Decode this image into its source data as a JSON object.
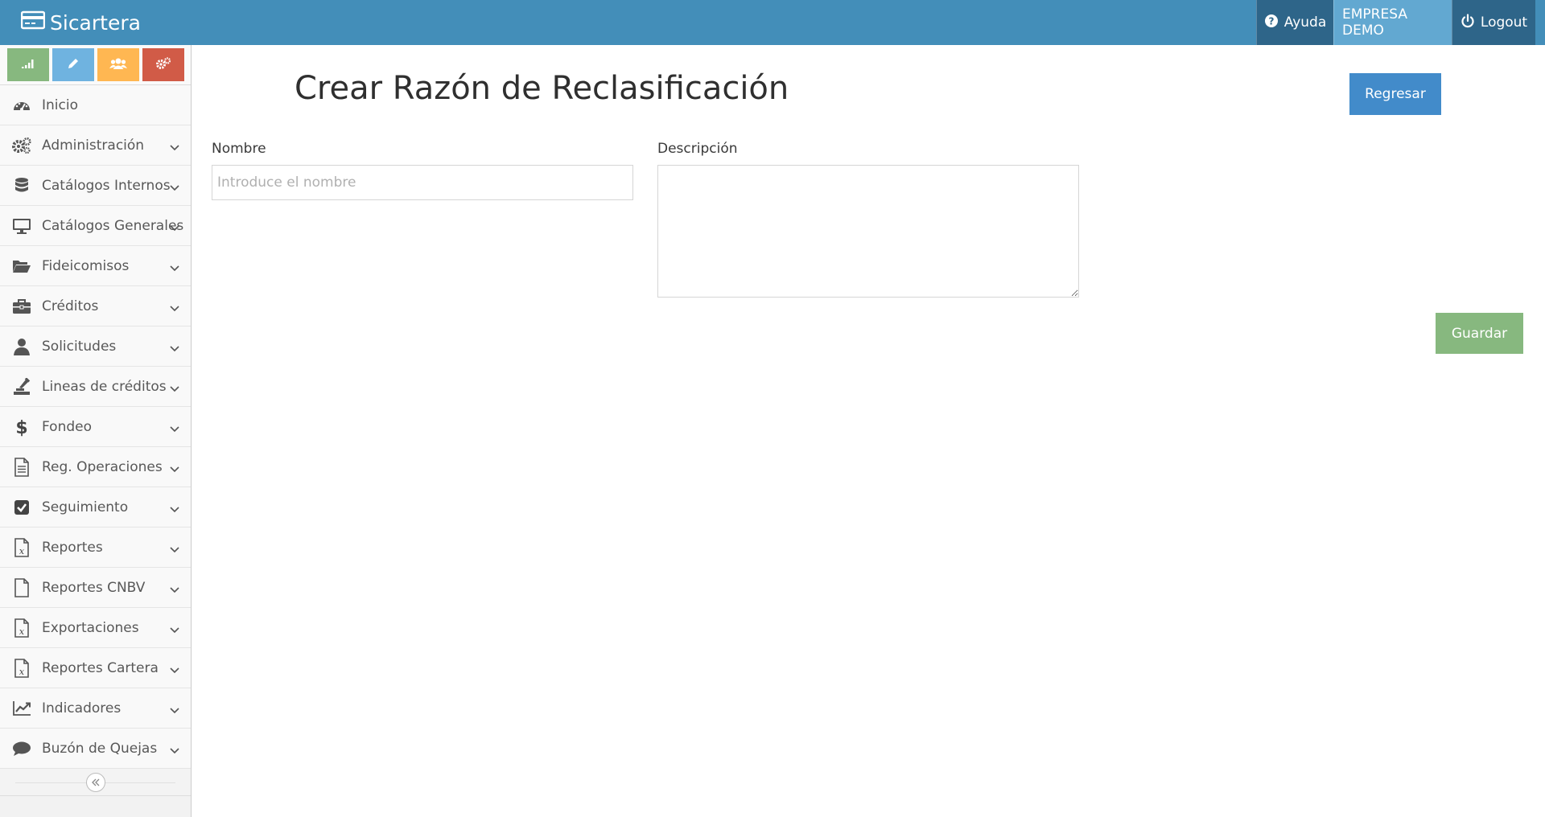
{
  "app": {
    "brand": "Sicartera",
    "brand_icon": "credit-card-icon"
  },
  "navbar": {
    "help_label": "Ayuda",
    "company_label": "EMPRESA DEMO",
    "logout_label": "Logout",
    "colors": {
      "bar": "#438eb9",
      "dark": "#2e6589",
      "company": "#62a8d1"
    }
  },
  "shortcuts": [
    {
      "icon": "signal-icon",
      "color": "#87b87f"
    },
    {
      "icon": "pencil-icon",
      "color": "#6fb3e0"
    },
    {
      "icon": "users-icon",
      "color": "#ffb752"
    },
    {
      "icon": "cogs-icon",
      "color": "#d15b47"
    }
  ],
  "sidebar": {
    "items": [
      {
        "label": "Inicio",
        "icon": "dashboard-icon",
        "has_submenu": false
      },
      {
        "label": "Administración",
        "icon": "cogs-icon",
        "has_submenu": true
      },
      {
        "label": "Catálogos Internos",
        "icon": "database-icon",
        "has_submenu": true
      },
      {
        "label": "Catálogos Generales",
        "icon": "desktop-icon",
        "has_submenu": true
      },
      {
        "label": "Fideicomisos",
        "icon": "folder-open-icon",
        "has_submenu": true
      },
      {
        "label": "Créditos",
        "icon": "briefcase-icon",
        "has_submenu": true
      },
      {
        "label": "Solicitudes",
        "icon": "user-icon",
        "has_submenu": true
      },
      {
        "label": "Lineas de créditos",
        "icon": "hand-holding-icon",
        "has_submenu": true
      },
      {
        "label": "Fondeo",
        "icon": "dollar-icon",
        "has_submenu": true
      },
      {
        "label": "Reg. Operaciones",
        "icon": "file-text-icon",
        "has_submenu": true
      },
      {
        "label": "Seguimiento",
        "icon": "check-square-icon",
        "has_submenu": true
      },
      {
        "label": "Reportes",
        "icon": "file-excel-icon",
        "has_submenu": true
      },
      {
        "label": "Reportes CNBV",
        "icon": "file-icon",
        "has_submenu": true
      },
      {
        "label": "Exportaciones",
        "icon": "file-excel-icon",
        "has_submenu": true
      },
      {
        "label": "Reportes Cartera",
        "icon": "file-excel-icon",
        "has_submenu": true
      },
      {
        "label": "Indicadores",
        "icon": "line-chart-icon",
        "has_submenu": true
      },
      {
        "label": "Buzón de Quejas",
        "icon": "comment-icon",
        "has_submenu": true
      }
    ],
    "collapse_icon": "double-angle-left-icon"
  },
  "main": {
    "title": "Crear Razón de Reclasificación",
    "back_button": "Regresar",
    "form": {
      "nombre_label": "Nombre",
      "nombre_placeholder": "Introduce el nombre",
      "nombre_value": "",
      "descripcion_label": "Descripción",
      "descripcion_value": ""
    },
    "save_button": "Guardar"
  }
}
